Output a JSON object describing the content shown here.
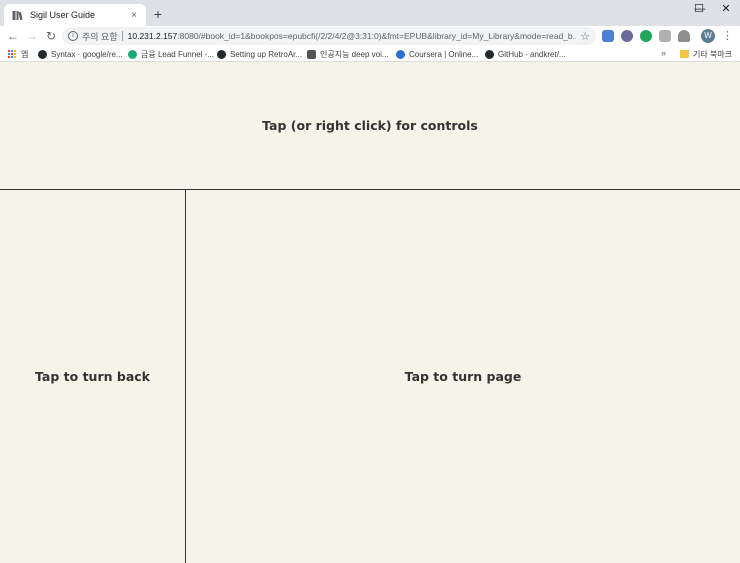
{
  "browser": {
    "tab": {
      "title": "Sigil User Guide",
      "close": "×"
    },
    "new_tab": "+",
    "window": {
      "minimize": "—",
      "maximize": "☐",
      "close": "✕"
    },
    "nav": {
      "back": "←",
      "forward": "→",
      "reload": "↻"
    },
    "omnibox": {
      "security_label": "주의 요함",
      "host": "10.231.2.157",
      "rest": ":8080/#book_id=1&bookpos=epubcfi(/2/2/4/2@3:31:0)&fmt=EPUB&library_id=My_Library&mode=read_b..."
    },
    "avatar_letter": "W",
    "menu": "⋮",
    "colors": {
      "tabstrip": "#dee1e6",
      "avatar": "#5f7e94"
    }
  },
  "bookmarks": {
    "apps_label": "앱",
    "items": [
      {
        "label": "Syntax · google/re..."
      },
      {
        "label": "금융 Lead Funnel -..."
      },
      {
        "label": "Setting up RetroAr..."
      },
      {
        "label": "인공지능 deep voi..."
      },
      {
        "label": "Coursera | Online..."
      },
      {
        "label": "GitHub - andkret/..."
      }
    ],
    "overflow": "»",
    "other_folder": "기타 북마크"
  },
  "reader": {
    "top_zone": "Tap (or right click) for controls",
    "left_zone": "Tap to turn back",
    "right_zone": "Tap to turn page",
    "colors": {
      "background": "#f6f3e9",
      "text": "#333333",
      "divider": "#333333"
    }
  }
}
